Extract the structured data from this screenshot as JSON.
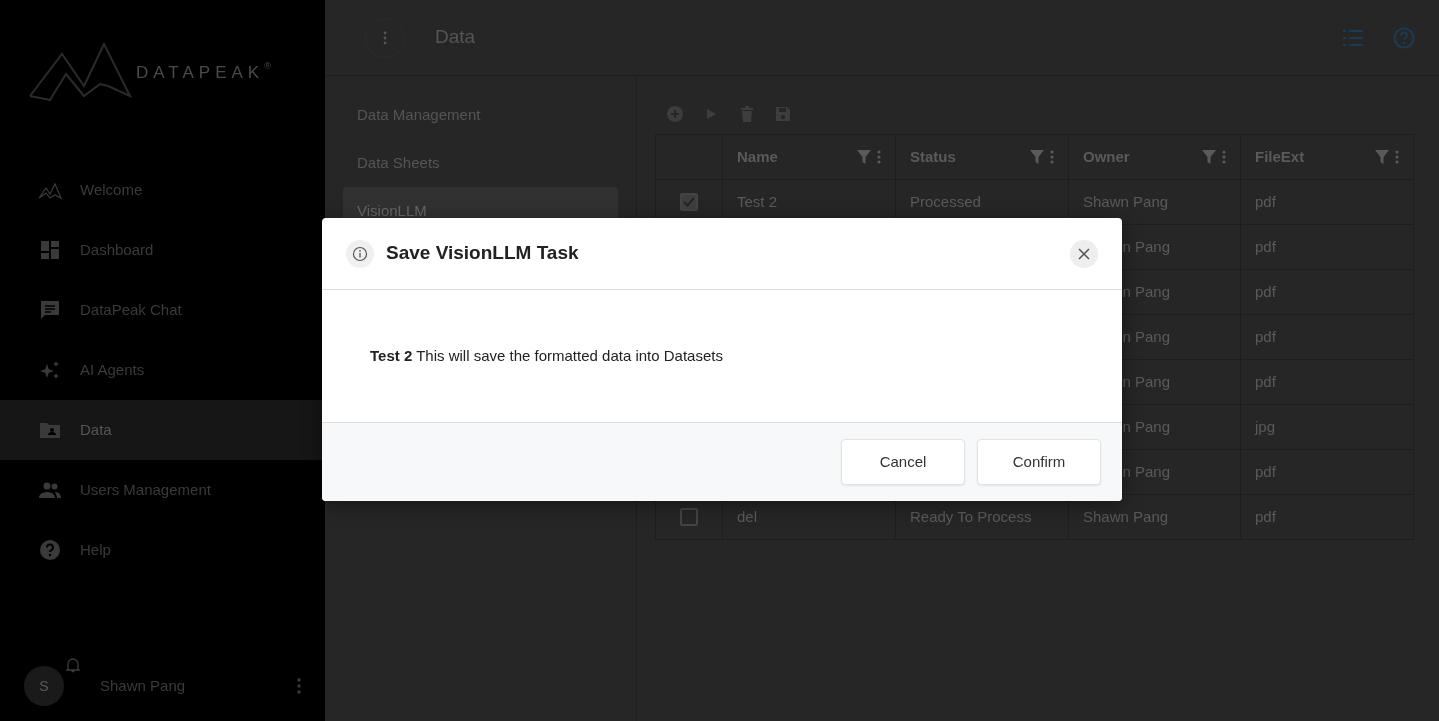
{
  "brand": {
    "name": "DATAPEAK",
    "mark": "®"
  },
  "sidebar": {
    "items": [
      {
        "label": "Welcome",
        "selected": false
      },
      {
        "label": "Dashboard",
        "selected": false
      },
      {
        "label": "DataPeak Chat",
        "selected": false
      },
      {
        "label": "AI Agents",
        "selected": false
      },
      {
        "label": "Data",
        "selected": true
      },
      {
        "label": "Users Management",
        "selected": false
      },
      {
        "label": "Help",
        "selected": false
      }
    ],
    "user": {
      "initial": "S",
      "name": "Shawn Pang"
    }
  },
  "header": {
    "title": "Data"
  },
  "subnav": [
    {
      "label": "Data Management",
      "selected": false
    },
    {
      "label": "Data Sheets",
      "selected": false
    },
    {
      "label": "VisionLLM",
      "selected": true
    }
  ],
  "table": {
    "columns": [
      "Name",
      "Status",
      "Owner",
      "FileExt"
    ],
    "rows": [
      {
        "checked": true,
        "name": "Test 2",
        "status": "Processed",
        "owner": "Shawn Pang",
        "fileext": "pdf"
      },
      {
        "owner": "n Pang",
        "fileext": "pdf"
      },
      {
        "owner": "n Pang",
        "fileext": "pdf"
      },
      {
        "owner": "n Pang",
        "fileext": "pdf"
      },
      {
        "owner": "n Pang",
        "fileext": "pdf"
      },
      {
        "owner": "n Pang",
        "fileext": "jpg"
      },
      {
        "owner": "n Pang",
        "fileext": "pdf"
      },
      {
        "checked": false,
        "name": "del",
        "status": "Ready To Process",
        "owner": "Shawn Pang",
        "fileext": "pdf"
      }
    ]
  },
  "dialog": {
    "title": "Save VisionLLM Task",
    "message": "**Test 2** This will save the formatted data into Datasets",
    "buttons": [
      "Cancel",
      "Confirm"
    ]
  }
}
